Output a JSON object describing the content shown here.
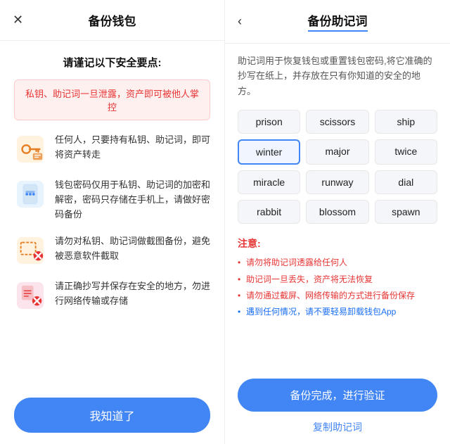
{
  "left": {
    "close_icon": "✕",
    "title": "备份钱包",
    "security_heading": "请谨记以下安全要点:",
    "warning_text": "私钥、助记词一旦泄露，资产即可被他人掌控",
    "items": [
      {
        "id": "item-key",
        "text": "任何人，只要持有私钥、助记词，即可将资产转走"
      },
      {
        "id": "item-password",
        "text": "钱包密码仅用于私钥、助记词的加密和解密，密码只存储在手机上，请做好密码备份"
      },
      {
        "id": "item-screenshot",
        "text": "请勿对私钥、助记词做截图备份，避免被恶意软件截取"
      },
      {
        "id": "item-copy",
        "text": "请正确抄写并保存在安全的地方，勿进行网络传输或存储"
      }
    ],
    "know_btn": "我知道了"
  },
  "right": {
    "back_icon": "‹",
    "title": "备份助记词",
    "description": "助记词用于恢复钱包或重置钱包密码,将它准确的抄写在纸上，并存放在只有你知道的安全的地方。",
    "words": [
      {
        "text": "prison",
        "highlighted": false
      },
      {
        "text": "scissors",
        "highlighted": false
      },
      {
        "text": "ship",
        "highlighted": false
      },
      {
        "text": "winter",
        "highlighted": true
      },
      {
        "text": "major",
        "highlighted": false
      },
      {
        "text": "twice",
        "highlighted": false
      },
      {
        "text": "miracle",
        "highlighted": false
      },
      {
        "text": "runway",
        "highlighted": false
      },
      {
        "text": "dial",
        "highlighted": false
      },
      {
        "text": "rabbit",
        "highlighted": false
      },
      {
        "text": "blossom",
        "highlighted": false
      },
      {
        "text": "spawn",
        "highlighted": false
      }
    ],
    "notes_title": "注意:",
    "notes": [
      "请勿将助记词透露给任何人",
      "助记词一旦丢失，资产将无法恢复",
      "请勿通过截屏、网络传输的方式进行备份保存",
      "遇到任何情况，请不要轻易卸载钱包App"
    ],
    "verify_btn": "备份完成，进行验证",
    "copy_link": "复制助记词"
  }
}
